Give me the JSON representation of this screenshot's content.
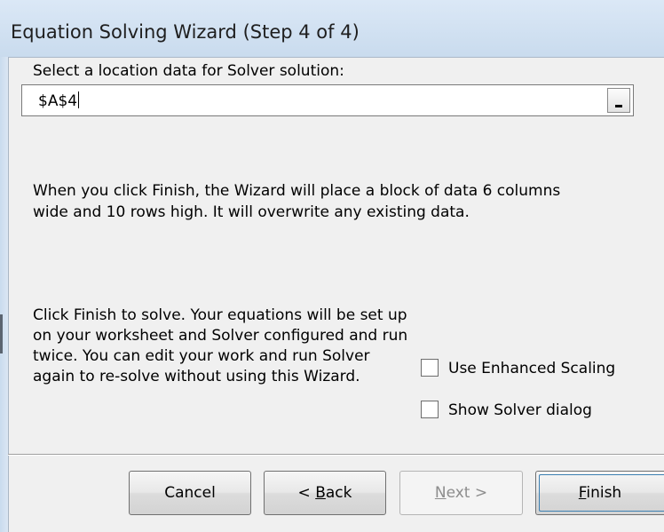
{
  "window": {
    "title": "Equation Solving Wizard (Step 4 of 4)"
  },
  "location": {
    "label": "Select a location data for Solver solution:",
    "value": "$A$4",
    "collapse_button_icon": "range-collapse-icon"
  },
  "info_text": "When you click Finish, the Wizard will place a block of data 6 columns wide and 10 rows high. It will overwrite any existing data.",
  "instructions_text": "Click Finish to solve. Your equations will be set up on your worksheet and Solver configured and run twice. You can edit your work and run Solver again to re-solve without using this Wizard.",
  "options": {
    "enhanced_scaling": {
      "label": "Use Enhanced Scaling",
      "checked": false
    },
    "show_solver_dialog": {
      "label": "Show Solver dialog",
      "checked": false
    }
  },
  "buttons": {
    "cancel": "Cancel",
    "back_prefix": "< ",
    "back_mnemonic": "B",
    "back_rest": "ack",
    "next_mnemonic": "N",
    "next_rest": "ext >",
    "next_enabled": false,
    "finish_mnemonic": "F",
    "finish_rest": "inish"
  },
  "colors": {
    "title_bar": "#c9dbee",
    "dialog_background": "#f0f0f0",
    "default_button_focus": "#3c7fb1",
    "disabled_text": "#8d8d8d"
  }
}
